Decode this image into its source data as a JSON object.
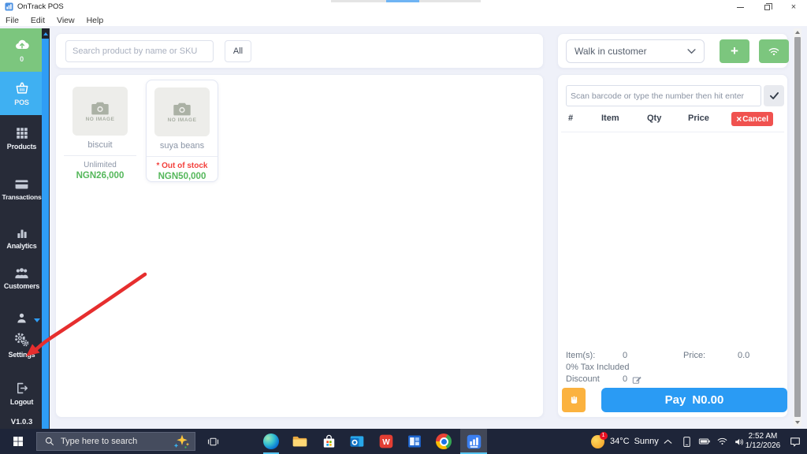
{
  "window": {
    "title": "OnTrack POS",
    "menu": {
      "file": "File",
      "edit": "Edit",
      "view": "View",
      "help": "Help"
    }
  },
  "sidebar": {
    "upload_badge": "0",
    "nav": {
      "pos": "POS",
      "products": "Products",
      "transactions": "Transactions",
      "analytics": "Analytics",
      "customers": "Customers",
      "settings": "Settings",
      "logout": "Logout"
    },
    "version": "V1.0.3"
  },
  "toolbar": {
    "search_placeholder": "Search product by name or SKU",
    "filter_all": "All",
    "customer_selected": "Walk in customer"
  },
  "products": {
    "no_image": "NO IMAGE",
    "items": [
      {
        "name": "biscuit",
        "availability": "Unlimited",
        "price": "NGN26,000"
      },
      {
        "name": "suya beans",
        "availability": "* Out of stock",
        "price": "NGN50,000"
      }
    ]
  },
  "cart": {
    "barcode_placeholder": "Scan barcode or type the number then hit enter",
    "headers": {
      "number": "#",
      "item": "Item",
      "qty": "Qty",
      "price": "Price"
    },
    "cancel": "Cancel",
    "summary": {
      "items_label": "Item(s):",
      "items_value": "0",
      "price_label": "Price:",
      "price_value": "0.0",
      "tax_note": "0% Tax Included",
      "discount_label": "Discount",
      "discount_value": "0"
    },
    "pay": {
      "label": "Pay",
      "amount": "N0.00"
    }
  },
  "taskbar": {
    "search_placeholder": "Type here to search",
    "apps": [
      "copilot",
      "edge",
      "file-explorer",
      "store",
      "outlook",
      "wps-office",
      "blue-window-app",
      "chrome",
      "ontrack-pos"
    ],
    "weather": {
      "badge": "1",
      "temp": "34°C",
      "condition": "Sunny"
    },
    "clock": {
      "time": "2:52 AM",
      "date": "1/12/2026"
    }
  },
  "icons": {
    "add": "+",
    "close": "×",
    "cancel_x": "×"
  },
  "colors": {
    "sidebar_bg": "#272b38",
    "active_blue": "#3fb0f2",
    "green": "#7cc67e",
    "price_green": "#54b75a",
    "danger_red": "#f0524f",
    "out_of_stock_red": "#f3413d",
    "pay_blue": "#2a9bf4",
    "hold_orange": "#fbb23f",
    "arrow_red": "#e62e2e",
    "taskbar_bg": "#1e2539",
    "scrollbar_blue": "#2f9df5"
  }
}
